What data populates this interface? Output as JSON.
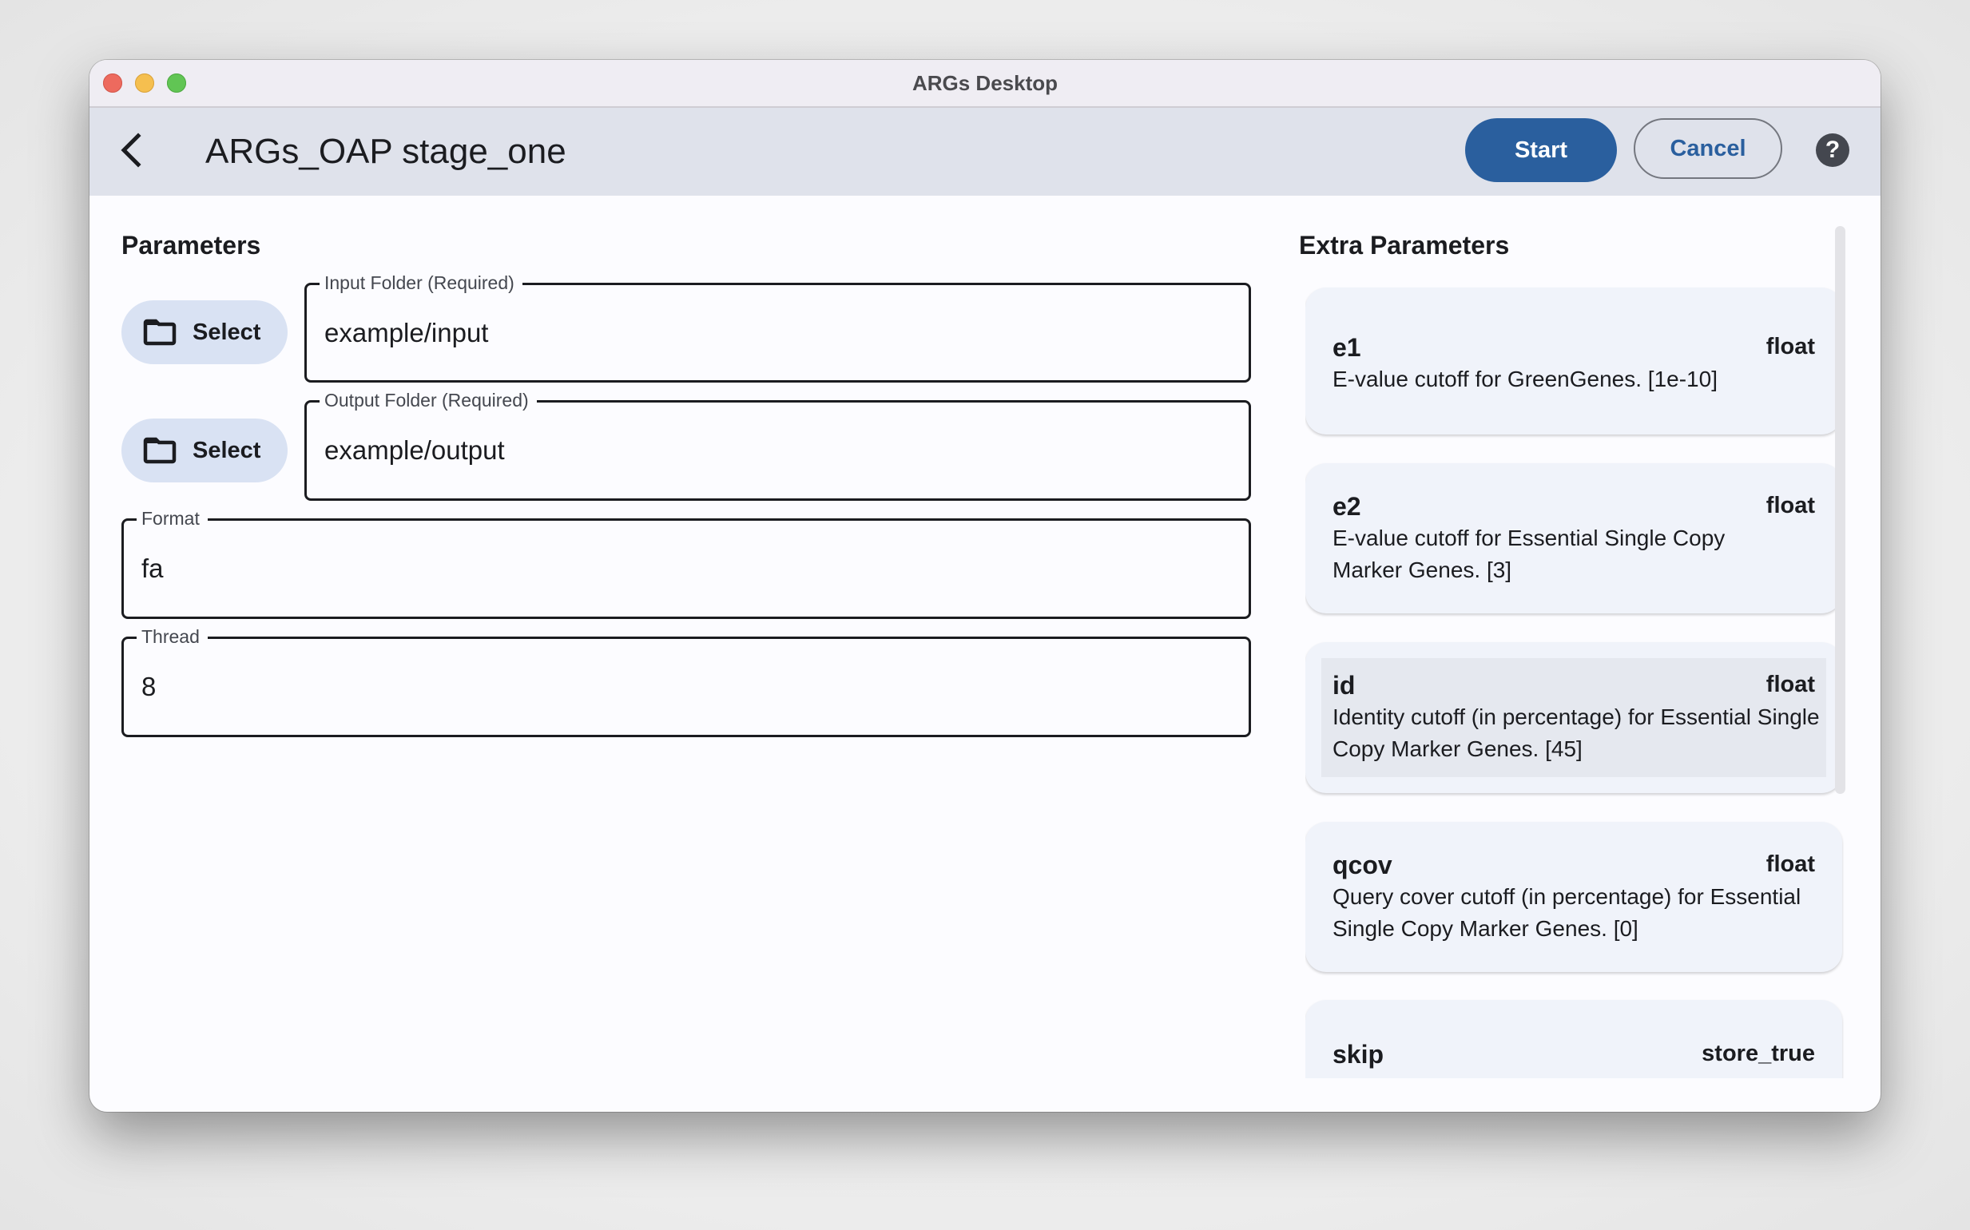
{
  "window": {
    "title": "ARGs Desktop"
  },
  "appbar": {
    "title": "ARGs_OAP stage_one",
    "back_icon": "chevron-left-icon",
    "start_label": "Start",
    "cancel_label": "Cancel",
    "help_icon": "help-circle-icon",
    "help_glyph": "?"
  },
  "colors": {
    "primary": "#2a5f9e",
    "appbar_bg": "#dfe2eb",
    "tonal_button_bg": "#d9e2f3",
    "card_bg": "#f0f3fa"
  },
  "parameters": {
    "title": "Parameters",
    "select_label": "Select",
    "folder_icon": "folder-icon",
    "fields": [
      {
        "label": "Input Folder (Required)",
        "value": "example/input"
      },
      {
        "label": "Output Folder (Required)",
        "value": "example/output"
      },
      {
        "label": "Format",
        "value": "fa"
      },
      {
        "label": "Thread",
        "value": "8"
      }
    ]
  },
  "extra_parameters": {
    "title": "Extra Parameters",
    "items": [
      {
        "name": "e1",
        "type": "float",
        "description": "E-value cutoff for GreenGenes. [1e-10]"
      },
      {
        "name": "e2",
        "type": "float",
        "description": "E-value cutoff for Essential Single Copy Marker Genes. [3]"
      },
      {
        "name": "id",
        "type": "float",
        "description": "Identity cutoff (in percentage) for Essential Single Copy Marker Genes. [45]"
      },
      {
        "name": "qcov",
        "type": "float",
        "description": "Query cover cutoff (in percentage) for Essential Single Copy Marker Genes. [0]"
      },
      {
        "name": "skip",
        "type": "store_true",
        "description": ""
      }
    ]
  }
}
